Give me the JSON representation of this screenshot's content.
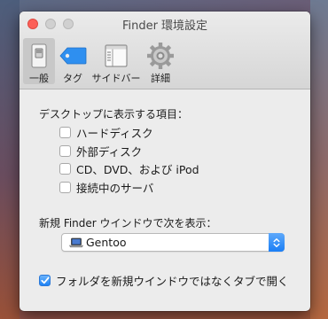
{
  "window": {
    "title": "Finder 環境設定"
  },
  "toolbar": {
    "items": [
      {
        "label": "一般",
        "icon": "general-switch-icon",
        "selected": true
      },
      {
        "label": "タグ",
        "icon": "tag-icon",
        "selected": false
      },
      {
        "label": "サイドバー",
        "icon": "sidebar-icon",
        "selected": false
      },
      {
        "label": "詳細",
        "icon": "gear-icon",
        "selected": false
      }
    ]
  },
  "desktop_items": {
    "title": "デスクトップに表示する項目：",
    "options": [
      {
        "label": "ハードディスク",
        "checked": false
      },
      {
        "label": "外部ディスク",
        "checked": false
      },
      {
        "label": "CD、DVD、および iPod",
        "checked": false
      },
      {
        "label": "接続中のサーバ",
        "checked": false
      }
    ]
  },
  "new_window": {
    "label": "新規 Finder ウインドウで次を表示：",
    "selected": "Gentoo",
    "icon": "laptop-icon"
  },
  "open_folders_in_tabs": {
    "label": "フォルダを新規ウインドウではなくタブで開く",
    "checked": true
  },
  "colors": {
    "accent": "#1c82f5",
    "close_button": "#fc5f57",
    "tag_blue": "#2e8ff0"
  }
}
